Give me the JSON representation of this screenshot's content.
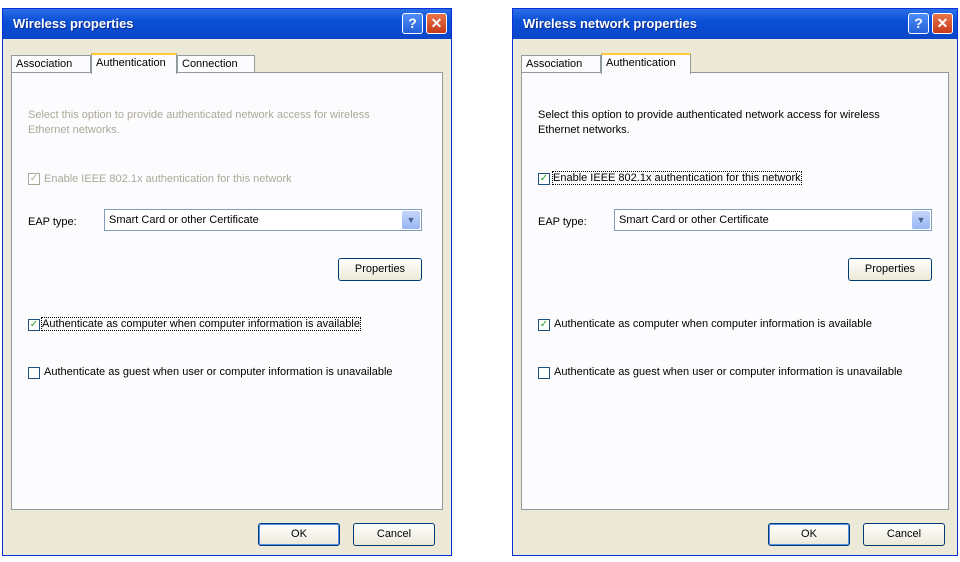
{
  "dialogs": [
    {
      "title": "Wireless properties",
      "tabs": [
        "Association",
        "Authentication",
        "Connection"
      ],
      "active_tab": "Authentication",
      "description": "Select this option to provide authenticated network access for wireless Ethernet networks.",
      "enable_8021x": {
        "label": "Enable IEEE 802.1x authentication for this network",
        "checked": true,
        "enabled": false
      },
      "eap_label": "EAP type:",
      "eap_value": "Smart Card or other Certificate",
      "properties_label": "Properties",
      "auth_computer": {
        "label": "Authenticate as computer when computer information is available",
        "checked": true
      },
      "auth_guest": {
        "label": "Authenticate as guest when user or computer information is unavailable",
        "checked": false
      },
      "ok_label": "OK",
      "cancel_label": "Cancel"
    },
    {
      "title": "Wireless network properties",
      "tabs": [
        "Association",
        "Authentication"
      ],
      "active_tab": "Authentication",
      "description": "Select this option to provide authenticated network access for wireless Ethernet networks.",
      "enable_8021x": {
        "label": "Enable IEEE 802.1x authentication for this network",
        "checked": true,
        "enabled": true
      },
      "eap_label": "EAP type:",
      "eap_value": "Smart Card or other Certificate",
      "properties_label": "Properties",
      "auth_computer": {
        "label": "Authenticate as computer when computer information is available",
        "checked": true
      },
      "auth_guest": {
        "label": "Authenticate as guest when user or computer information is unavailable",
        "checked": false
      },
      "ok_label": "OK",
      "cancel_label": "Cancel"
    }
  ],
  "icons": {
    "help": "?",
    "close": "✕",
    "dropdown": "▼",
    "check": "✓"
  },
  "colors": {
    "titlebar": "#0a4fd6",
    "dialog_bg": "#ece9d8",
    "tab_highlight": "#ffc83c",
    "check": "#21a121"
  }
}
